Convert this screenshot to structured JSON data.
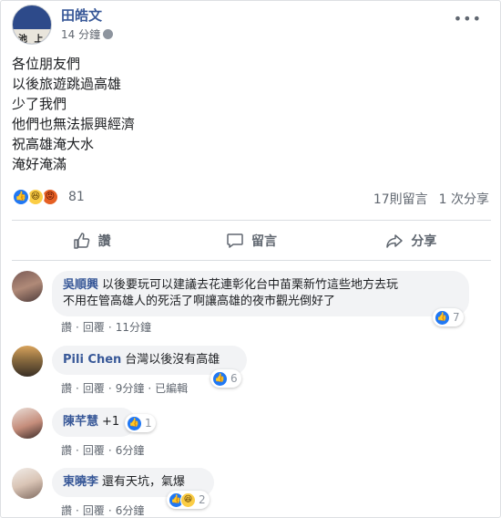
{
  "post": {
    "author": "田皓文",
    "time": "14 分鐘",
    "more_icon": "more-horizontal-icon",
    "lines": [
      "各位朋友們",
      "以後旅遊跳過高雄",
      "少了我們",
      "他們也無法振興經濟",
      "祝高雄淹大水",
      "淹好淹滿"
    ],
    "reaction_count": "81",
    "comments_count": "17則留言",
    "shares_count": "1 次分享",
    "reactions": [
      "like",
      "haha",
      "angry"
    ]
  },
  "actions": {
    "like": "讚",
    "comment": "留言",
    "share": "分享"
  },
  "colors": {
    "link": "#385898",
    "like_blue": "#2078f4",
    "haha_yellow": "#fbcd45",
    "angry_orange": "#e55f23",
    "bubble_bg": "#f2f3f5"
  },
  "comments": [
    {
      "name": "吳順興",
      "text_line1": "以後要玩可以建議去花連彰化台中苗栗新竹這些地方去玩",
      "text_line2": "不用在管高雄人的死活了啊讓高雄的夜市觀光倒好了",
      "like": "讚",
      "reply": "回覆",
      "time": "11分鐘",
      "reaction_count": "7"
    },
    {
      "name": "Pili Chen",
      "text": "台灣以後沒有高雄",
      "like": "讚",
      "reply": "回覆",
      "time": "9分鐘",
      "edited": "已編輯",
      "reaction_count": "6"
    },
    {
      "name": "陳芊慧",
      "text": "+1",
      "like": "讚",
      "reply": "回覆",
      "time": "6分鐘",
      "reaction_count": "1"
    },
    {
      "name": "東曉李",
      "text": "還有天坑，氣爆",
      "like": "讚",
      "reply": "回覆",
      "time": "6分鐘",
      "reaction_count": "2"
    }
  ]
}
